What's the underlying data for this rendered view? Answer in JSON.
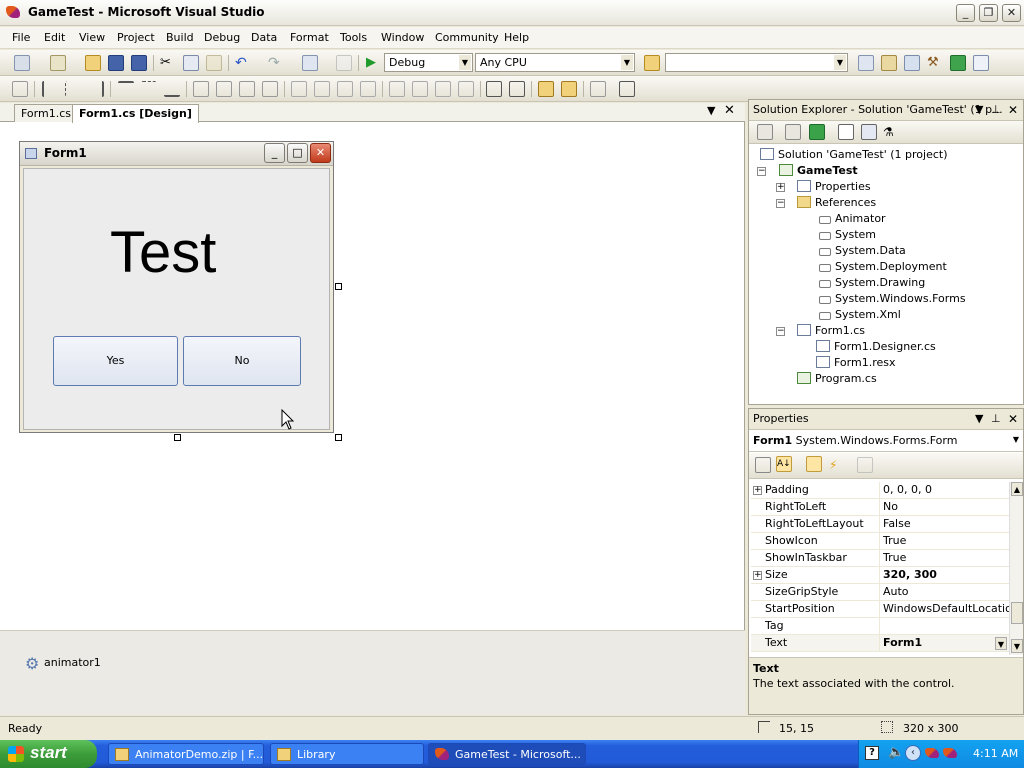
{
  "window": {
    "title": "GameTest - Microsoft Visual Studio"
  },
  "menu": [
    "File",
    "Edit",
    "View",
    "Project",
    "Build",
    "Debug",
    "Data",
    "Format",
    "Tools",
    "Window",
    "Community",
    "Help"
  ],
  "toolbar": {
    "config": "Debug",
    "platform": "Any CPU",
    "find": ""
  },
  "tabs": {
    "tab1": "Form1.cs",
    "tab2": "Form1.cs [Design]"
  },
  "form": {
    "title": "Form1",
    "label": "Test",
    "yes": "Yes",
    "no": "No"
  },
  "tray": {
    "component": "animator1"
  },
  "solution": {
    "header": "Solution Explorer - Solution 'GameTest' (1 p...",
    "root": "Solution 'GameTest' (1 project)",
    "project": "GameTest",
    "properties": "Properties",
    "references": "References",
    "refs": [
      "Animator",
      "System",
      "System.Data",
      "System.Deployment",
      "System.Drawing",
      "System.Windows.Forms",
      "System.Xml"
    ],
    "form1cs": "Form1.cs",
    "children": [
      "Form1.Designer.cs",
      "Form1.resx"
    ],
    "program": "Program.cs"
  },
  "properties": {
    "header": "Properties",
    "object_name": "Form1",
    "object_type": "System.Windows.Forms.Form",
    "rows": [
      {
        "name": "Padding",
        "value": "0, 0, 0, 0",
        "expand": true,
        "bold": false
      },
      {
        "name": "RightToLeft",
        "value": "No",
        "expand": false,
        "bold": false
      },
      {
        "name": "RightToLeftLayout",
        "value": "False",
        "expand": false,
        "bold": false
      },
      {
        "name": "ShowIcon",
        "value": "True",
        "expand": false,
        "bold": false
      },
      {
        "name": "ShowInTaskbar",
        "value": "True",
        "expand": false,
        "bold": false
      },
      {
        "name": "Size",
        "value": "320, 300",
        "expand": true,
        "bold": true
      },
      {
        "name": "SizeGripStyle",
        "value": "Auto",
        "expand": false,
        "bold": false
      },
      {
        "name": "StartPosition",
        "value": "WindowsDefaultLocation",
        "expand": false,
        "bold": false
      },
      {
        "name": "Tag",
        "value": "",
        "expand": false,
        "bold": false
      },
      {
        "name": "Text",
        "value": "Form1",
        "expand": false,
        "bold": true
      }
    ],
    "desc_title": "Text",
    "desc_text": "The text associated with the control."
  },
  "status": {
    "text": "Ready",
    "position": "15, 15",
    "size": "320 x 300"
  },
  "taskbar": {
    "start": "start",
    "tasks": [
      "AnimatorDemo.zip | F...",
      "Library",
      "GameTest - Microsoft..."
    ],
    "clock": "4:11 AM"
  }
}
